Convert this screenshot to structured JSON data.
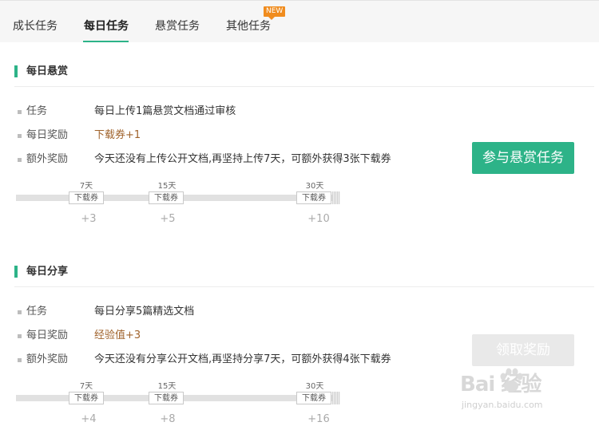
{
  "tabs": [
    {
      "label": "成长任务",
      "active": false
    },
    {
      "label": "每日任务",
      "active": true
    },
    {
      "label": "悬赏任务",
      "active": false
    },
    {
      "label": "其他任务",
      "active": false
    }
  ],
  "new_badge": "NEW",
  "sections": [
    {
      "title": "每日悬赏",
      "task_label": "任务",
      "task_value": "每日上传1篇悬赏文档通过审核",
      "reward_label": "每日奖励",
      "reward_value": "下载券+1",
      "extra_label": "额外奖励",
      "extra_value": "今天还没有上传公开文档,再坚持上传7天，可额外获得3张下载券",
      "button_label": "参与悬赏任务",
      "button_enabled": true,
      "milestones": [
        {
          "day": "7天",
          "chip": "下载券",
          "bonus": "+3"
        },
        {
          "day": "15天",
          "chip": "下载券",
          "bonus": "+5"
        },
        {
          "day": "30天",
          "chip": "下载券",
          "bonus": "+10"
        }
      ]
    },
    {
      "title": "每日分享",
      "task_label": "任务",
      "task_value": "每日分享5篇精选文档",
      "reward_label": "每日奖励",
      "reward_value": "经验值+3",
      "extra_label": "额外奖励",
      "extra_value": "今天还没有分享公开文档,再坚持分享7天，可额外获得4张下载券",
      "button_label": "领取奖励",
      "button_enabled": false,
      "milestones": [
        {
          "day": "7天",
          "chip": "下载券",
          "bonus": "+4"
        },
        {
          "day": "15天",
          "chip": "下载券",
          "bonus": "+8"
        },
        {
          "day": "30天",
          "chip": "下载券",
          "bonus": "+16"
        }
      ]
    }
  ],
  "watermark": {
    "logo": "Bai 经验",
    "url": "jingyan.baidu.com"
  },
  "colors": {
    "accent": "#2db388",
    "badge": "#f08c1e",
    "reward_text": "#a0632c"
  }
}
